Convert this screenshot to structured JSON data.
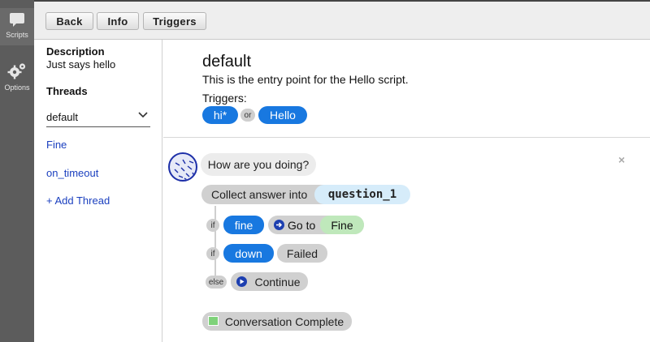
{
  "rail": {
    "scripts_label": "Scripts",
    "options_label": "Options"
  },
  "toolbar": {
    "back_label": "Back",
    "info_label": "Info",
    "triggers_label": "Triggers"
  },
  "left_panel": {
    "description_heading": "Description",
    "description_text": "Just says hello",
    "threads_heading": "Threads",
    "selected_thread": "default",
    "threads": [
      "Fine",
      "on_timeout"
    ],
    "add_thread_label": "+ Add Thread"
  },
  "thread_header": {
    "title": "default",
    "description": "This is the entry point for the Hello script.",
    "triggers_label": "Triggers:",
    "trigger_1": "hi*",
    "or_label": "or",
    "trigger_2": "Hello"
  },
  "script": {
    "message": "How are you doing?",
    "collect_label": "Collect answer into",
    "variable": "question_1",
    "if_label": "if",
    "else_label": "else",
    "cond_1": "fine",
    "goto_label": "Go to",
    "goto_target": "Fine",
    "cond_2": "down",
    "failed_label": "Failed",
    "continue_label": "Continue",
    "complete_label": "Conversation Complete",
    "close_symbol": "×"
  },
  "colors": {
    "accent_blue": "#1878e0",
    "goto_green": "#bfe8bb",
    "variable_blue": "#d6ecfa",
    "rail": "#5c5c5c"
  }
}
